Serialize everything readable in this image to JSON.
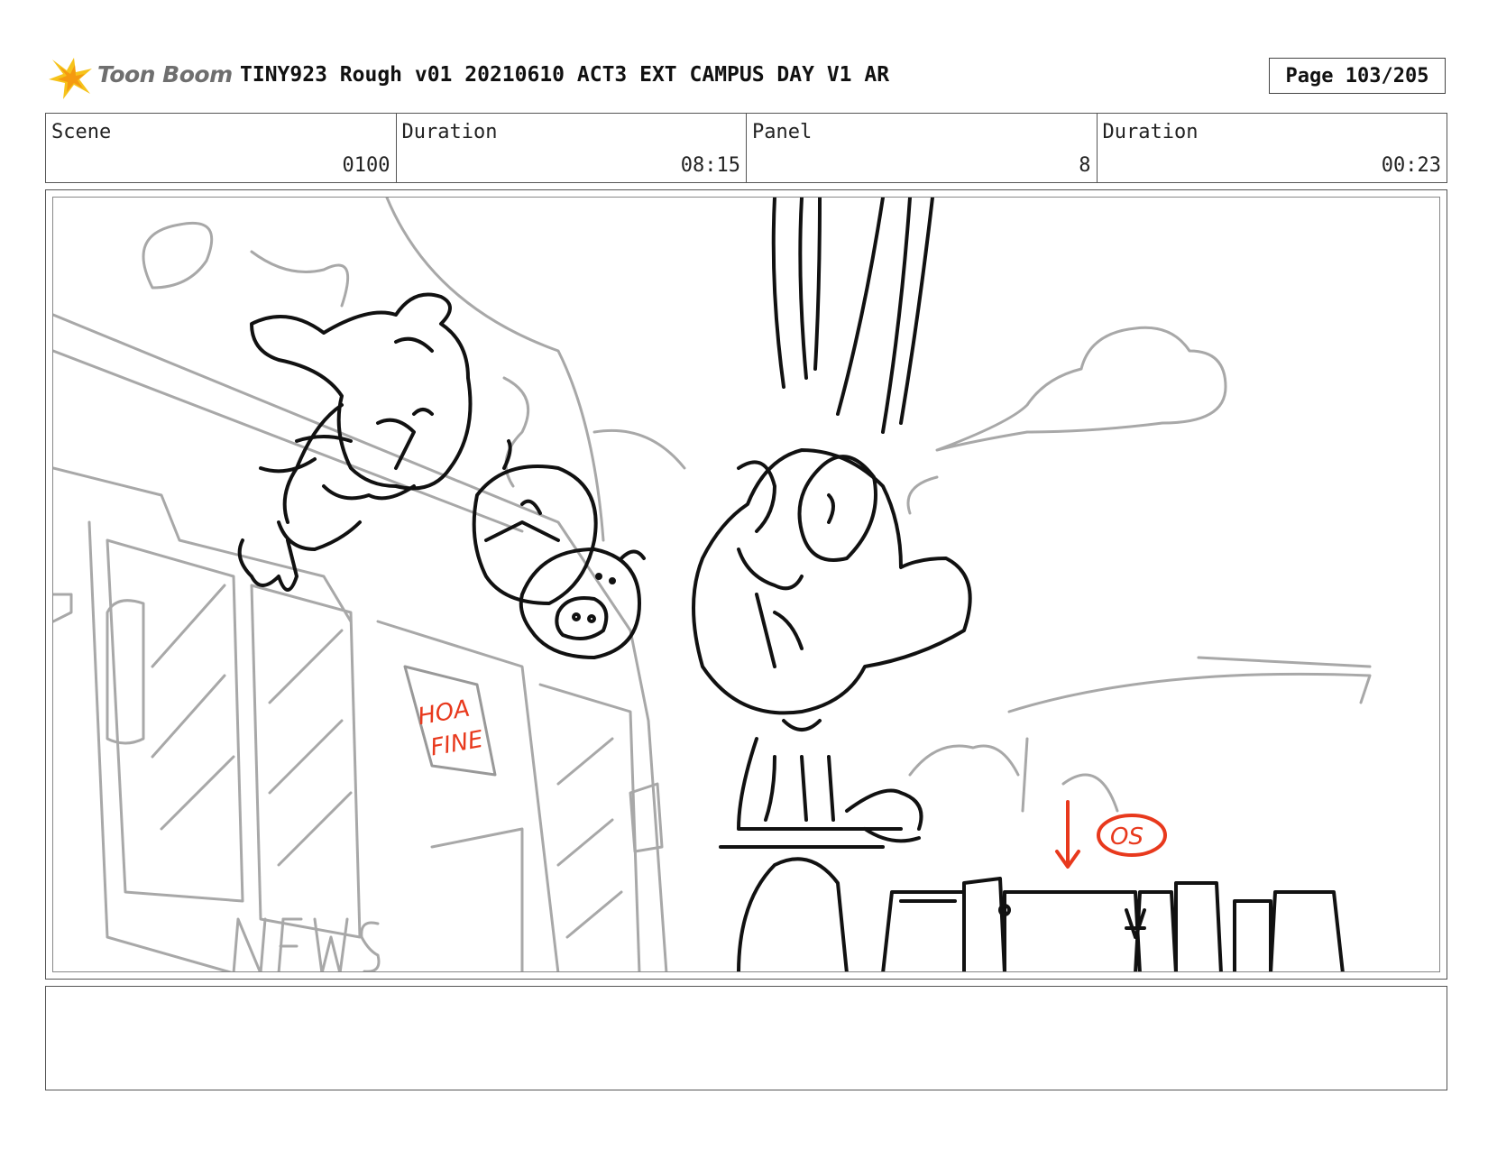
{
  "header": {
    "logo_text": "Toon Boom",
    "title": "TINY923 Rough v01 20210610 ACT3 EXT CAMPUS DAY V1 AR",
    "page": "Page 103/205"
  },
  "info": [
    {
      "label": "Scene",
      "value": "0100"
    },
    {
      "label": "Duration",
      "value": "08:15"
    },
    {
      "label": "Panel",
      "value": "8"
    },
    {
      "label": "Duration",
      "value": "00:23"
    }
  ],
  "panel": {
    "sign_text": [
      "HOA",
      "FINE"
    ],
    "news_text": "NEWS",
    "note_text": "OS",
    "colors": {
      "annotation": "#e8391d",
      "sketch": "#111111",
      "background_lines": "#a8a8a8"
    }
  },
  "notes": {
    "text": ""
  }
}
